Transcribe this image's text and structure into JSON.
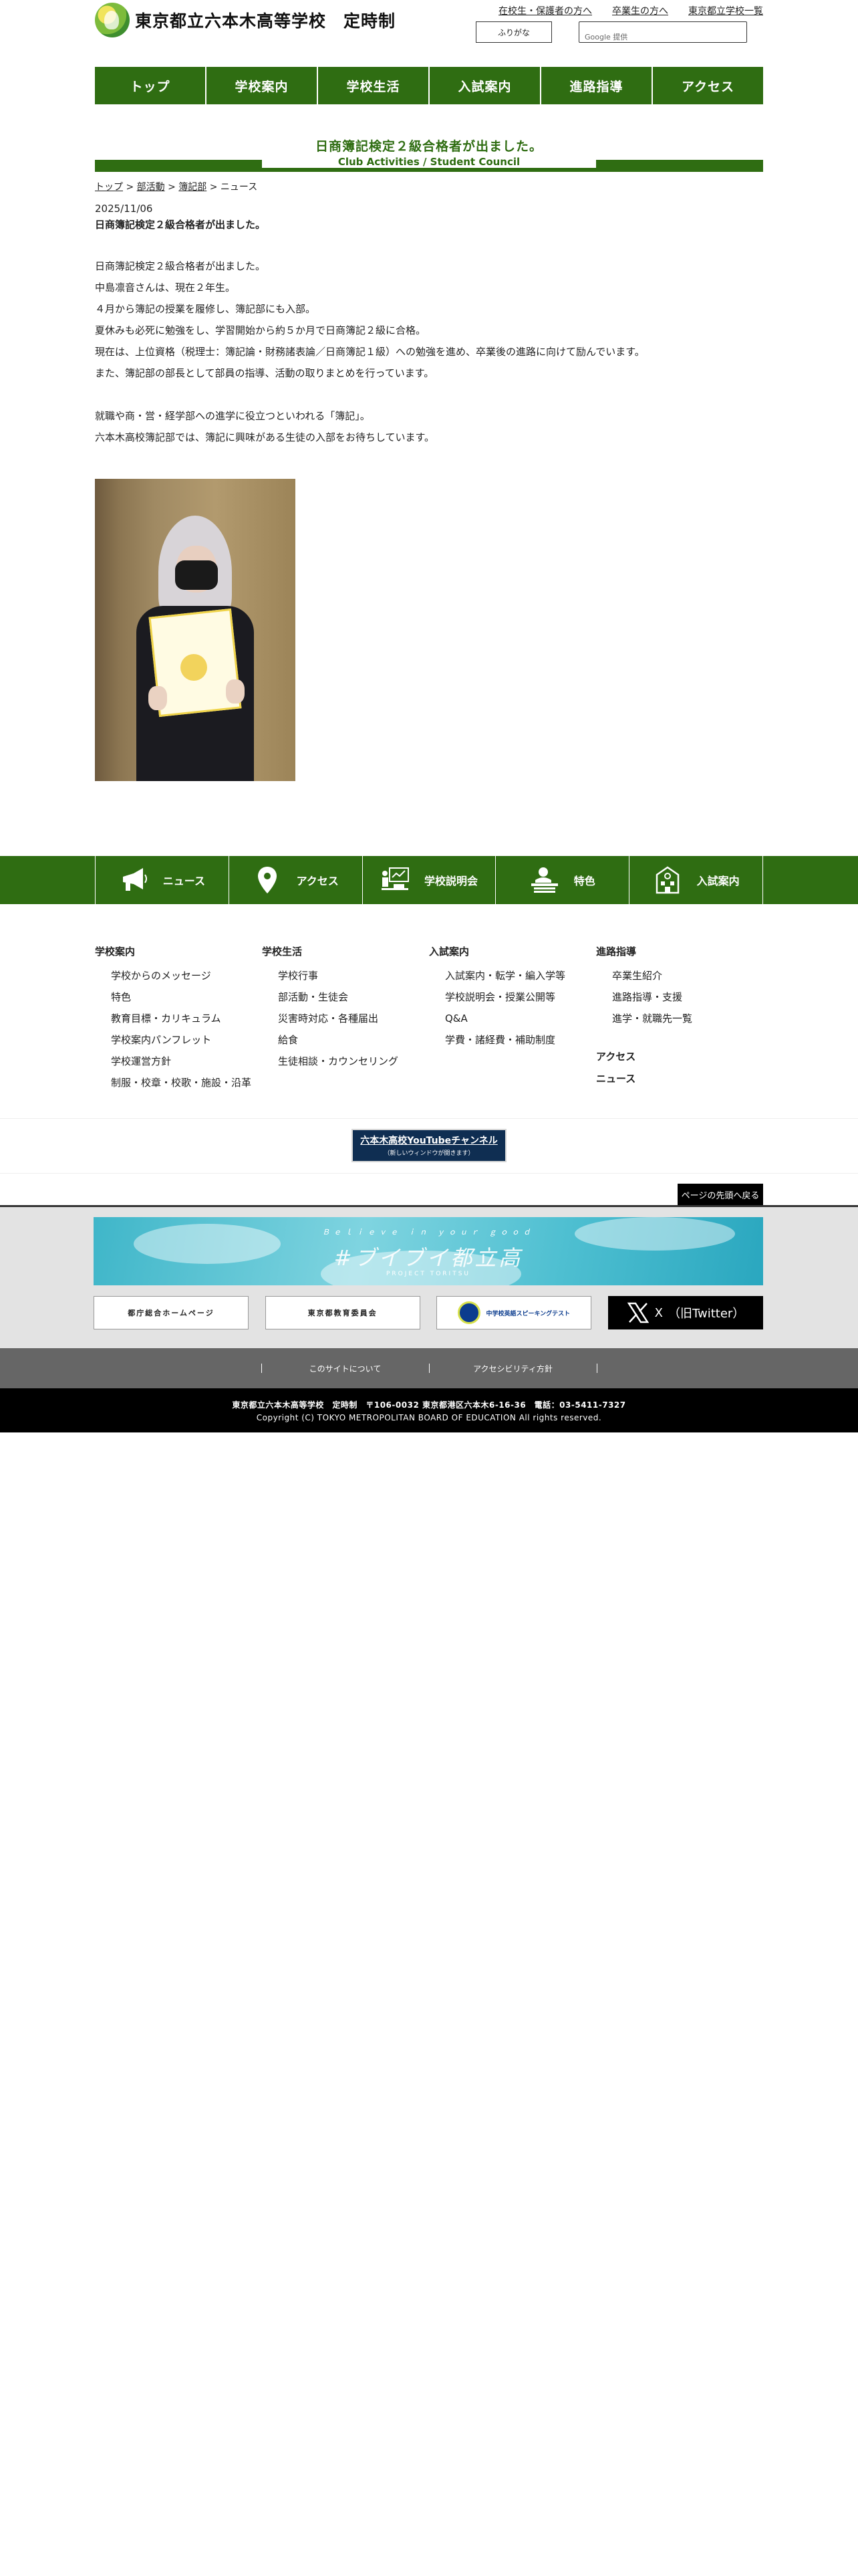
{
  "header": {
    "school_name": "東京都立六本木高等学校　定時制",
    "top_links": [
      "在校生・保護者の方へ",
      "卒業生の方へ",
      "東京都立学校一覧"
    ],
    "furigana_button": "ふりがな",
    "search_placeholder": "Google 提供"
  },
  "nav": [
    "トップ",
    "学校案内",
    "学校生活",
    "入試案内",
    "進路指導",
    "アクセス"
  ],
  "page": {
    "title": "日商簿記検定２級合格者が出ました。",
    "subtitle": "Club Activities / Student Council",
    "breadcrumb": [
      "トップ",
      "部活動",
      "簿記部",
      "ニュース"
    ],
    "date": "2025/11/06",
    "heading": "日商簿記検定２級合格者が出ました。",
    "paragraphs": [
      "日商簿記検定２級合格者が出ました。",
      "中島凛音さんは、現在２年生。",
      "４月から簿記の授業を履修し、簿記部にも入部。",
      "夏休みも必死に勉強をし、学習開始から約５か月で日商簿記２級に合格。",
      "現在は、上位資格（税理士：簿記論・財務諸表論／日商簿記１級）への勉強を進め、卒業後の進路に向けて励んでいます。",
      "また、簿記部の部長として部員の指導、活動の取りまとめを行っています。",
      "",
      "就職や商・営・経学部への進学に役立つといわれる「簿記」。",
      "六本木高校簿記部では、簿記に興味がある生徒の入部をお待ちしています。"
    ]
  },
  "icon_nav": [
    {
      "label": "ニュース",
      "icon": "megaphone-icon"
    },
    {
      "label": "アクセス",
      "icon": "map-pin-icon"
    },
    {
      "label": "学校説明会",
      "icon": "presentation-icon"
    },
    {
      "label": "特色",
      "icon": "study-icon"
    },
    {
      "label": "入試案内",
      "icon": "school-icon"
    }
  ],
  "sitemap": {
    "col1": {
      "title": "学校案内",
      "items": [
        "学校からのメッセージ",
        "特色",
        "教育目標・カリキュラム",
        "学校案内パンフレット",
        "学校運営方針",
        "制服・校章・校歌・施設・沿革"
      ]
    },
    "col2": {
      "title": "学校生活",
      "items": [
        "学校行事",
        "部活動・生徒会",
        "災害時対応・各種届出",
        "給食",
        "生徒相談・カウンセリング"
      ]
    },
    "col3": {
      "title": "入試案内",
      "items": [
        "入試案内・転学・編入学等",
        "学校説明会・授業公開等",
        "Q&A",
        "学費・諸経費・補助制度"
      ]
    },
    "col4": {
      "title": "進路指導",
      "items": [
        "卒業生紹介",
        "進路指導・支援",
        "進学・就職先一覧"
      ],
      "extra": [
        "アクセス",
        "ニュース"
      ]
    }
  },
  "youtube": {
    "main": "六本木高校YouTubeチャンネル",
    "sub": "（新しいウィンドウが開きます）"
  },
  "to_top": "ページの先頭へ戻る",
  "sky_banner": {
    "sub": "Ｂｅｌｉｅｖｅ ｉｎ ｙｏｕｒ ｇｏｏｄ",
    "main": "#ブイブイ都立高",
    "tag": "PROJECT TORITSU"
  },
  "footer_banners": [
    "都庁総合ホームページ",
    "東京都教育委員会",
    "中学校英語スピーキングテスト",
    "（旧Twitter）"
  ],
  "footer_links": [
    "このサイトについて",
    "アクセシビリティ方針"
  ],
  "footer": {
    "address": "東京都立六本木高等学校　定時制　〒106-0032 東京都港区六本木6-16-36　電話：03-5411-7327",
    "copyright": "Copyright (C) TOKYO METROPOLITAN BOARD OF EDUCATION All rights reserved."
  }
}
